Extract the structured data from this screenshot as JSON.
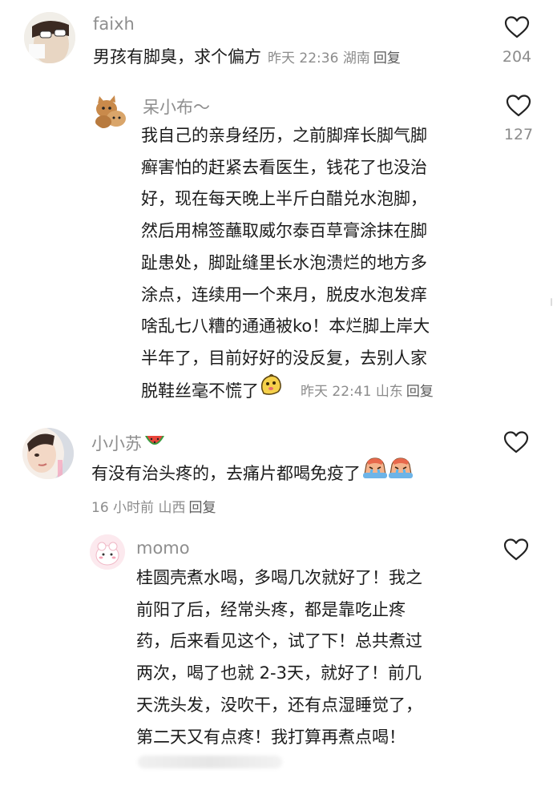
{
  "comments": [
    {
      "username": "faixh",
      "text": "男孩有脚臭，求个偏方",
      "time": "昨天 22:36",
      "location": "湖南",
      "reply_label": "回复",
      "likes": "204"
    },
    {
      "username": "呆小布～",
      "lines": [
        "我自己的亲身经历，之前脚痒长脚气脚",
        "癣害怕的赶紧去看医生，钱花了也没治",
        "好，现在每天晚上半斤白醋兑水泡脚，",
        "然后用棉签蘸取威尔泰百草膏涂抹在脚",
        "趾患处，脚趾缝里长水泡溃烂的地方多",
        "涂点，连续用一个来月，脱皮水泡发痒",
        "啥乱七八糟的通通被ko！本烂脚上岸大",
        "半年了，目前好好的没反复，去别人家",
        "脱鞋丝毫不慌了"
      ],
      "time": "昨天 22:41",
      "location": "山东",
      "reply_label": "回复",
      "likes": "127"
    },
    {
      "username": "小小苏",
      "text": "有没有治头疼的，去痛片都喝免疫了",
      "time": "16 小时前",
      "location": "山西",
      "reply_label": "回复"
    },
    {
      "username": "momo",
      "lines": [
        "桂圆壳煮水喝，多喝几次就好了！我之",
        "前阳了后，经常头疼，都是靠吃止疼",
        "药，后来看见这个，试了下！总共煮过",
        "两次，喝了也就 2-3天，就好了！前几",
        "天洗头发，没吹干，还有点湿睡觉了，",
        "第二天又有点疼！我打算再煮点喝！"
      ]
    }
  ],
  "colors": {
    "text": "#1c1c1c",
    "muted": "#8c8c8c",
    "reply": "#5b5b5b"
  },
  "icons": [
    "heart-outline-icon",
    "watermelon-emoji",
    "blob-emoji",
    "crying-emoji"
  ]
}
